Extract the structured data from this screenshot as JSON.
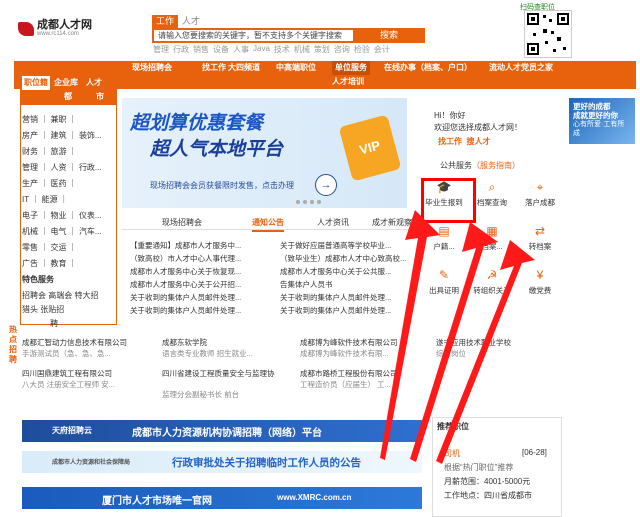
{
  "header": {
    "logo_text": "成都人才网",
    "logo_sub": "www.rc114.com",
    "search_tab_active": "工作",
    "search_tab_other": "人才",
    "search_placeholder": "请输入您要搜索的关键字，暂不支持多个关键字搜索",
    "search_button": "搜索",
    "hot_words": [
      "管理",
      "行政",
      "销售",
      "设备",
      "人事",
      "Java",
      "技术",
      "机械",
      "策划",
      "咨询",
      "检验",
      "会计"
    ],
    "qr_label": "扫码查职位"
  },
  "nav": {
    "row1": [
      "现场招聘会",
      "找工作",
      "大四频道",
      "中高端职位",
      "单位服务",
      "在线办事（档案、户口）",
      "流动人才党员之家"
    ],
    "row2": [
      "人才培训"
    ],
    "left_tabs": [
      "职位籍",
      "企业库",
      "人才",
      "都",
      "市"
    ]
  },
  "left_categories": [
    [
      "营销",
      "｜",
      "兼职",
      "｜"
    ],
    [
      "房产",
      "｜",
      "建筑",
      "｜",
      "装饰..."
    ],
    [
      "财务",
      "｜",
      "旅游",
      "｜"
    ],
    [
      "管理",
      "｜",
      "人资",
      "｜",
      "行政..."
    ],
    [
      "生产",
      "｜",
      "医药",
      "｜"
    ],
    [
      "IT",
      "｜",
      "能源",
      "｜"
    ],
    [
      "电子",
      "｜",
      "物业",
      "｜",
      "仪表..."
    ],
    [
      "机械",
      "｜",
      "电气",
      "｜",
      "汽车..."
    ],
    [
      "零售",
      "｜",
      "交运",
      "｜"
    ],
    [
      "广告",
      "｜",
      "教育",
      "｜"
    ]
  ],
  "left_special": {
    "title": "特色服务",
    "items": [
      "招聘会",
      "高端会",
      "特大招",
      "猎头",
      "张贴招",
      "聘"
    ]
  },
  "hot_side": "热点招聘",
  "banner": {
    "line1": "超划算优惠套餐",
    "line2": "超人气本地平台",
    "line3": "现场招聘会会员获餐限时发售，点击办理",
    "vip": "VIP"
  },
  "tabs": [
    "现场招聘会",
    "通知公告",
    "人才资讯",
    "成才新观察"
  ],
  "news_left": [
    "【重要通知】成都市人才服务中...",
    "（致高校）市人才中心人事代理...",
    "成都市人才服务中心关于恢复现...",
    "成都市人才服务中心关于公开招...",
    "关于收到的集体户人员邮件处理...",
    "关于收到的集体户人员邮件处理..."
  ],
  "news_right": [
    "关于做好应届普通高等学校毕业...",
    "（致毕业生）成都市人才中心致高校...",
    "成都市人才服务中心关于公共服...",
    "告集体户人员书",
    "关于收到的集体户人员邮件处理...",
    "关于收到的集体户人员邮件处理..."
  ],
  "welcome": {
    "greet": "Hi！你好",
    "text": "欢迎您选择成都人才网！",
    "links": [
      "找工作",
      "搜人才"
    ]
  },
  "public_service": {
    "title": "公共服务",
    "guide": "（服务指南）",
    "items": [
      "毕业生报到",
      "档案查询",
      "落户成都",
      "户籍...",
      "档案...",
      "转档案",
      "出具证明",
      "转组织关系",
      "缴党费"
    ]
  },
  "side_promo": {
    "line1": "更好的成都",
    "line2": "成就更好的你",
    "line3": "心有所爱·工有所成"
  },
  "companies": [
    {
      "name": "成都汇智动力信息技术有限公司",
      "desc": "手游测试员（急、急、急..."
    },
    {
      "name": "成都东软学院",
      "desc": "语言类专业教师 招生就业..."
    },
    {
      "name": "成都博为峰软件技术有限公司",
      "desc": "成都博为峰软件技术有限..."
    },
    {
      "name": "遂宁应用技术职业学校",
      "desc": "综合岗位"
    },
    {
      "name": "四川国鼎建筑工程有限公司",
      "desc": "八大员 注册安全工程师 安..."
    },
    {
      "name": "四川省建设工程质量安全与监理协",
      "desc": "监理分会副秘书长 前台"
    },
    {
      "name": "成都市路桥工程股份有限公司",
      "desc": "工程造价员（应届生） 工..."
    }
  ],
  "ads": [
    {
      "label": "天府招聘云",
      "text": "成都市人力资源机构协调招聘（网络）平台"
    },
    {
      "label": "成都市人力资源和社会保障局",
      "text": "行政审批处关于招聘临时工作人员的公告"
    },
    {
      "label": "厦门市人才市场唯一官网",
      "text": "www.XMRC.com.cn"
    }
  ],
  "recommend": {
    "title": "推荐职位",
    "job": "司机",
    "date": "[06-28]",
    "line2": "根据“热门职位”推荐",
    "salary": "月薪范围：4001-5000元",
    "location": "工作地点：四川省成都市"
  },
  "colors": {
    "brand": "#e8620e",
    "highlight": "#ff0000"
  }
}
